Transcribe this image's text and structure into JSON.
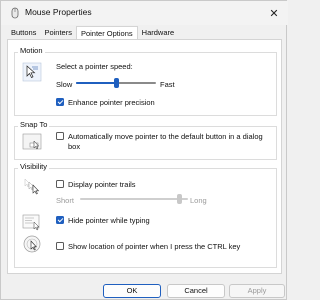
{
  "window": {
    "title": "Mouse Properties",
    "close_glyph": "✕"
  },
  "tabs": [
    {
      "label": "Buttons"
    },
    {
      "label": "Pointers"
    },
    {
      "label": "Pointer Options"
    },
    {
      "label": "Hardware"
    }
  ],
  "motion": {
    "group_label": "Motion",
    "speed_label": "Select a pointer speed:",
    "slow_label": "Slow",
    "fast_label": "Fast",
    "speed_value": 0.5,
    "enhance_label": "Enhance pointer precision",
    "enhance_checked": true
  },
  "snap_to": {
    "group_label": "Snap To",
    "auto_move_label_line1": "Automatically move pointer to the default button in a dialog",
    "auto_move_label_line2": "box",
    "auto_move_checked": false
  },
  "visibility": {
    "group_label": "Visibility",
    "trails_label": "Display pointer trails",
    "trails_checked": false,
    "short_label": "Short",
    "long_label": "Long",
    "trails_length_value": 0.94,
    "hide_typing_label": "Hide pointer while typing",
    "hide_typing_checked": true,
    "show_location_label": "Show location of pointer when I press the CTRL key",
    "show_location_checked": false
  },
  "footer": {
    "ok_label": "OK",
    "cancel_label": "Cancel",
    "apply_label": "Apply"
  },
  "colors": {
    "accent": "#1f5fbf",
    "panel": "#ffffff",
    "window_bg": "#f0f0f0"
  }
}
